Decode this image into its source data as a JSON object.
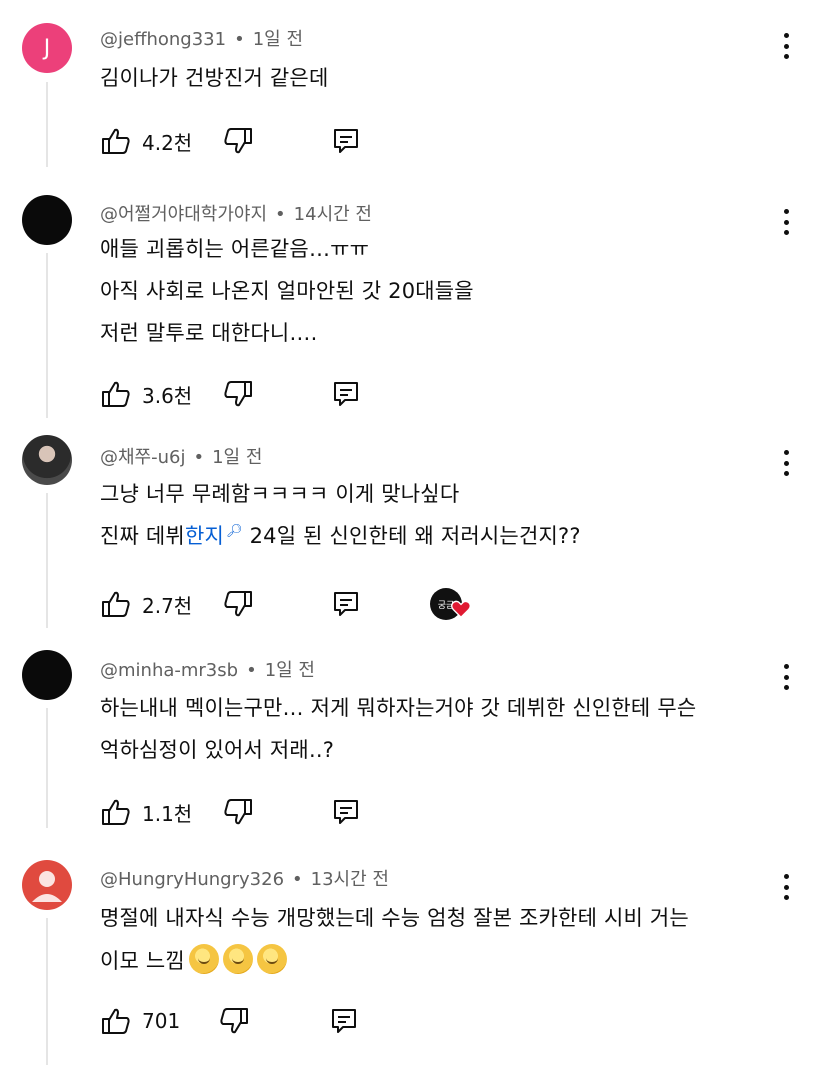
{
  "comments": [
    {
      "avatar_letter": "J",
      "author": "@jeffhong331",
      "time": "1일 전",
      "lines": [
        "김이나가 건방진거 같은데"
      ],
      "likes": "4.2천"
    },
    {
      "author": "@어쩔거야대학가야지",
      "time": "14시간 전",
      "lines": [
        "애들 괴롭히는 어른같음…ㅠㅠ",
        "아직 사회로 나온지 얼마안된 갓 20대들을",
        "저런 말투로 대한다니…."
      ],
      "likes": "3.6천"
    },
    {
      "author": "@채쭈-u6j",
      "time": "1일 전",
      "lines": [
        "그냥 너무 무례함ㅋㅋㅋㅋ 이게 맞나싶다"
      ],
      "line2_prefix": "진짜 데뷔",
      "line2_link": "한지",
      "line2_suffix": " 24일 된 신인한테 왜 저러시는건지??",
      "likes": "2.7천",
      "creator_badge": "궁금"
    },
    {
      "author": "@minha-mr3sb",
      "time": "1일 전",
      "lines": [
        "하는내내 멕이는구만… 저게 뭐하자는거야 갓 데뷔한 신인한테 무슨",
        "억하심정이 있어서 저래..?"
      ],
      "likes": "1.1천"
    },
    {
      "author": "@HungryHungry326",
      "time": "13시간 전",
      "lines": [
        "명절에 내자식 수능 개망했는데 수능 엄청 잘본 조카한테 시비 거는",
        "이모 느낌"
      ],
      "likes": "701"
    }
  ],
  "meta_separator": "•",
  "icons": {
    "like": "thumbs-up-icon",
    "dislike": "thumbs-down-icon",
    "reply": "reply-icon",
    "more": "more-vertical-icon",
    "search": "search-icon",
    "emoji": "melting-face-emoji"
  },
  "colors": {
    "link": "#065fd4",
    "meta": "#606060",
    "avatar_j": "#ec407a",
    "heart": "#e01a32"
  }
}
